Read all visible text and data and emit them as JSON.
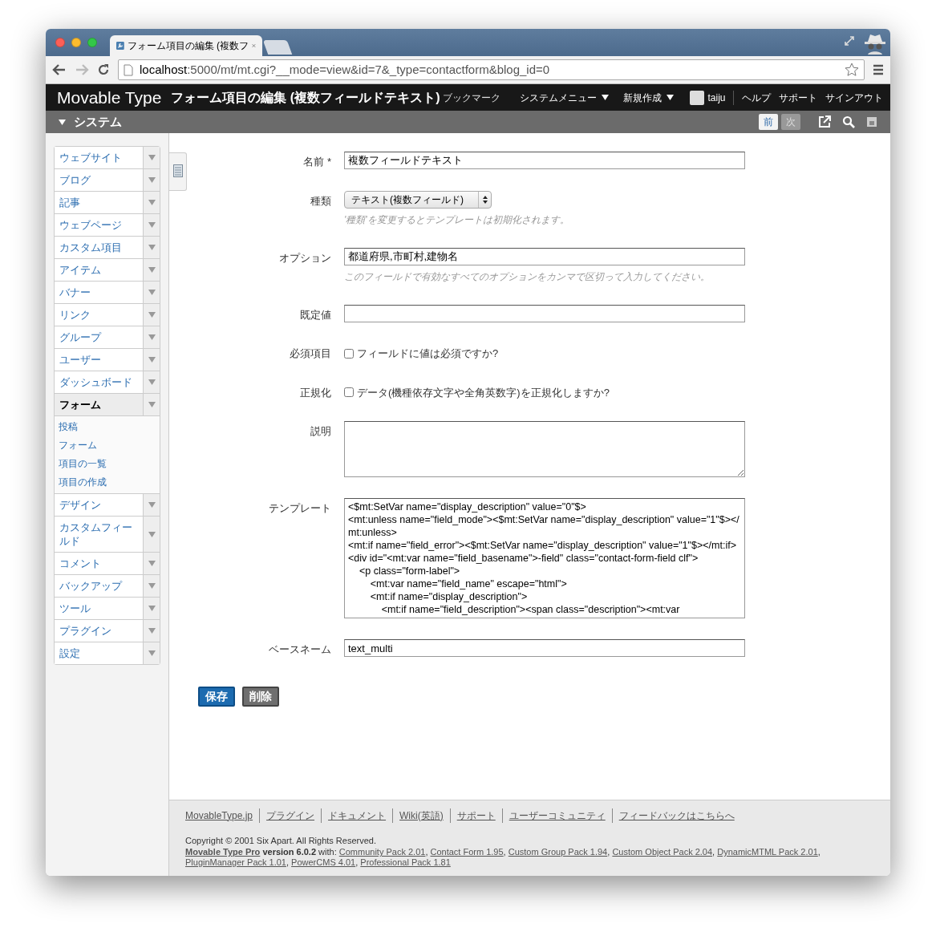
{
  "browser": {
    "tabs": [
      {
        "title": "フォーム項目の編集 (複数フ",
        "selected": true
      }
    ],
    "url_host": "localhost",
    "url_rest": ":5000/mt/mt.cgi?__mode=view&id=7&_type=contactform&blog_id=0"
  },
  "header": {
    "logo": "Movable Type",
    "page_title": "フォーム項目の編集 (複数フィールドテキスト)",
    "bookmark": "ブックマーク",
    "menus": [
      {
        "label": "システムメニュー"
      },
      {
        "label": "新規作成"
      }
    ],
    "user": "taiju",
    "links": [
      "ヘルプ",
      "サポート",
      "サインアウト"
    ]
  },
  "subheader": {
    "scope": "システム",
    "prev": {
      "label": "前",
      "disabled": false
    },
    "next": {
      "label": "次",
      "disabled": true
    }
  },
  "sidebar": {
    "menus": [
      {
        "label": "ウェブサイト",
        "selected": false
      },
      {
        "label": "ブログ",
        "selected": false
      },
      {
        "label": "記事",
        "selected": false
      },
      {
        "label": "ウェブページ",
        "selected": false
      },
      {
        "label": "カスタム項目",
        "selected": false
      },
      {
        "label": "アイテム",
        "selected": false
      },
      {
        "label": "バナー",
        "selected": false
      },
      {
        "label": "リンク",
        "selected": false
      },
      {
        "label": "グループ",
        "selected": false
      },
      {
        "label": "ユーザー",
        "selected": false
      },
      {
        "label": "ダッシュボード",
        "selected": false
      },
      {
        "label": "フォーム",
        "selected": true,
        "children": [
          "投稿",
          "フォーム",
          "項目の一覧",
          "項目の作成"
        ]
      },
      {
        "label": "デザイン",
        "selected": false
      },
      {
        "label": "カスタムフィールド",
        "selected": false
      },
      {
        "label": "コメント",
        "selected": false
      },
      {
        "label": "バックアップ",
        "selected": false
      },
      {
        "label": "ツール",
        "selected": false
      },
      {
        "label": "プラグイン",
        "selected": false
      },
      {
        "label": "設定",
        "selected": false
      }
    ]
  },
  "form": {
    "fields": [
      {
        "kind": "text",
        "label": "名前 *",
        "value": "複数フィールドテキスト"
      },
      {
        "kind": "select",
        "label": "種類",
        "value": "テキスト(複数フィールド)",
        "hint": "'種類'を変更するとテンプレートは初期化されます。"
      },
      {
        "kind": "text",
        "label": "オプション",
        "value": "都道府県,市町村,建物名",
        "hint": "このフィールドで有効なすべてのオプションをカンマで区切って入力してください。"
      },
      {
        "kind": "text",
        "label": "既定値"
      },
      {
        "kind": "checkbox",
        "label": "必須項目",
        "text": "フィールドに値は必須ですか?",
        "checked": false
      },
      {
        "kind": "checkbox",
        "label": "正規化",
        "text": "データ(機種依存文字や全角英数字)を正規化しますか?",
        "checked": false
      },
      {
        "kind": "textarea",
        "label": "説明"
      },
      {
        "kind": "code",
        "label": "テンプレート",
        "lines": [
          "<$mt:SetVar name=\"display_description\" value=\"0\"$>",
          "<mt:unless name=\"field_mode\"><$mt:SetVar name=\"display_description\" value=\"1\"$></mt:unless>",
          "<mt:if name=\"field_error\"><$mt:SetVar name=\"display_description\" value=\"1\"$></mt:if>",
          "<div id=\"<mt:var name=\"field_basename\">-field\" class=\"contact-form-field clf\">",
          "    <p class=\"form-label\">",
          "        <mt:var name=\"field_name\" escape=\"html\">",
          "        <mt:if name=\"display_description\">",
          "            <mt:if name=\"field_description\"><span class=\"description\"><mt:var"
        ]
      },
      {
        "kind": "text",
        "label": "ベースネーム",
        "value": "text_multi"
      }
    ],
    "buttons": [
      {
        "label": "保存",
        "kind": "primary"
      },
      {
        "label": "削除",
        "kind": "secondary"
      }
    ]
  },
  "footer": {
    "links": [
      "MovableType.jp",
      "プラグイン",
      "ドキュメント",
      "Wiki(英語)",
      "サポート",
      "ユーザーコミュニティ",
      "フィードバックはこちらへ"
    ],
    "copyright": "Copyright © 2001 Six Apart. All Rights Reserved.",
    "product": "Movable Type Pro",
    "version": "version 6.0.2",
    "with": "with:",
    "plugin_separator": ",",
    "plugins": [
      "Community Pack 2.01",
      "Contact Form 1.95",
      "Custom Group Pack 1.94",
      "Custom Object Pack 2.04",
      "DynamicMTML Pack 2.01",
      "PluginManager Pack 1.01",
      "PowerCMS 4.01",
      "Professional Pack 1.81"
    ]
  }
}
